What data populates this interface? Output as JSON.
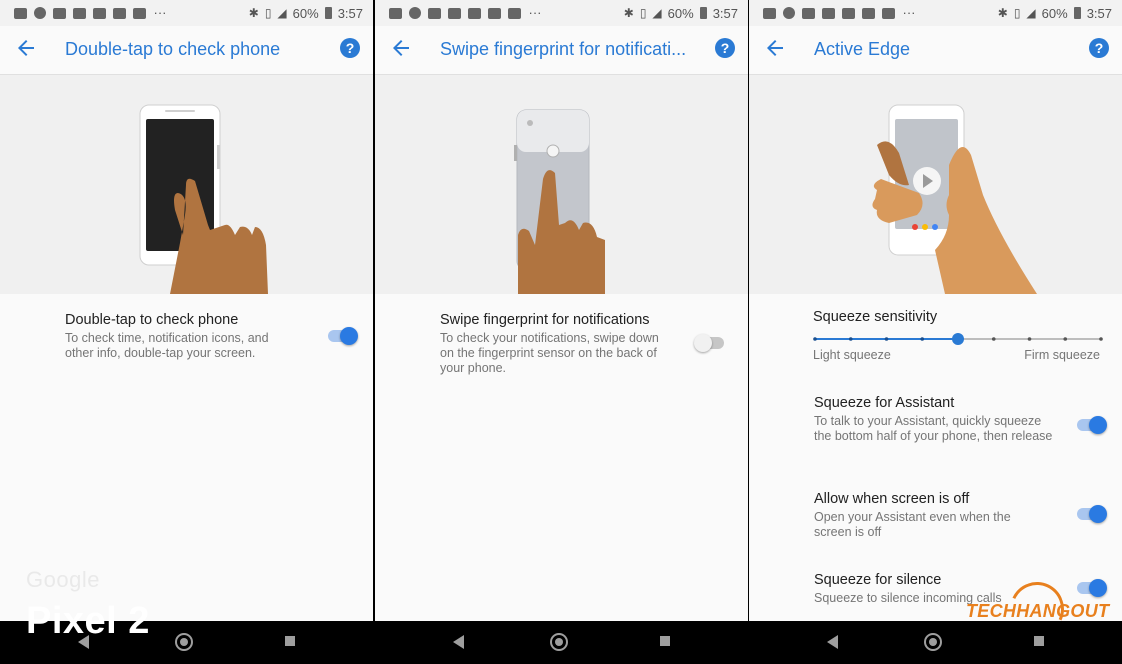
{
  "status_bar": {
    "battery": "60%",
    "time": "3:57",
    "network": "LTE"
  },
  "panels": [
    {
      "title": "Double-tap to check phone",
      "help_label": "?",
      "setting": {
        "title": "Double-tap to check phone",
        "subtitle": "To check time, notification icons, and other info, double-tap your screen.",
        "enabled": true
      }
    },
    {
      "title": "Swipe fingerprint for notificati...",
      "help_label": "?",
      "setting": {
        "title": "Swipe fingerprint for notifications",
        "subtitle": "To check your notifications, swipe down on the fingerprint sensor on the back of your phone.",
        "enabled": false
      }
    },
    {
      "title": "Active Edge",
      "help_label": "?",
      "slider": {
        "title": "Squeeze sensitivity",
        "min_label": "Light squeeze",
        "max_label": "Firm squeeze",
        "steps": 9,
        "value_step": 4
      },
      "settings": [
        {
          "title": "Squeeze for Assistant",
          "subtitle": "To talk to your Assistant, quickly squeeze the bottom half of your phone, then release",
          "enabled": true
        },
        {
          "title": "Allow when screen is off",
          "subtitle": "Open your Assistant even when the screen is off",
          "enabled": true
        },
        {
          "title": "Squeeze for silence",
          "subtitle": "Squeeze to silence incoming calls",
          "enabled": true
        }
      ]
    }
  ],
  "watermarks": {
    "google": "Google",
    "pixel": "Pixel 2",
    "brand": "TECHHANGOUT"
  },
  "colors": {
    "accent": "#2a7ad4",
    "hand": "#c98a4f",
    "background": "#fafafa"
  }
}
